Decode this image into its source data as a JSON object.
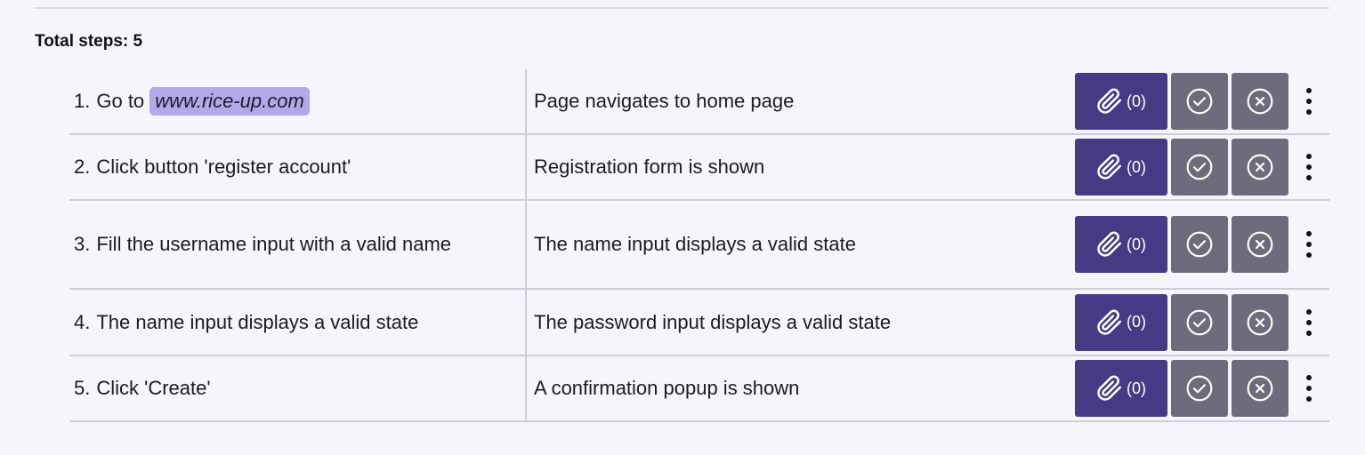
{
  "header": {
    "total_steps_label": "Total steps: 5"
  },
  "steps": [
    {
      "number": "1.",
      "action_prefix": "Go to",
      "action_link": "www.rice-up.com",
      "expected": "Page navigates to home page",
      "attachments": "(0)"
    },
    {
      "number": "2.",
      "action": "Click button 'register account'",
      "expected": "Registration form is shown",
      "attachments": "(0)"
    },
    {
      "number": "3.",
      "action": "Fill the username input with a valid name",
      "expected": "The name input displays a valid state",
      "attachments": "(0)"
    },
    {
      "number": "4.",
      "action": "The name input displays a valid state",
      "expected": "The password input displays a valid state",
      "attachments": "(0)"
    },
    {
      "number": "5.",
      "action": "Click 'Create'",
      "expected": "A confirmation popup is shown",
      "attachments": "(0)"
    }
  ],
  "icons": {
    "attach": "paperclip-icon",
    "pass": "check-circle-icon",
    "fail": "x-circle-icon",
    "more": "more-vertical-icon"
  },
  "colors": {
    "background": "#f6f5fc",
    "attach_button": "#463a84",
    "status_button": "#6d6c7c",
    "link_chip": "#b4a8ea"
  }
}
